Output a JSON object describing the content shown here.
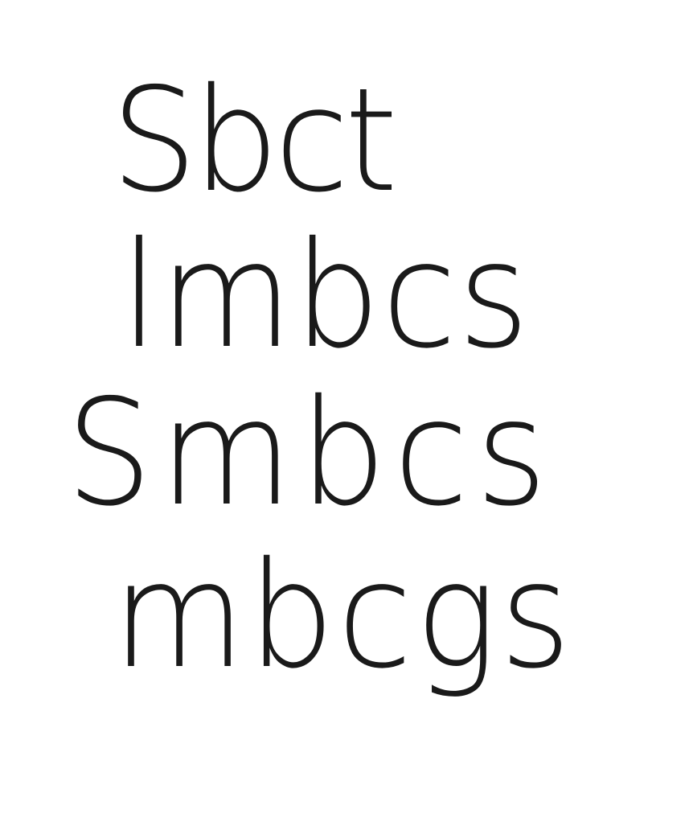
{
  "lines": [
    {
      "text": "Sbct"
    },
    {
      "text": "lmbcs"
    },
    {
      "text": "Smbcs"
    },
    {
      "text": "mbcgs"
    }
  ]
}
